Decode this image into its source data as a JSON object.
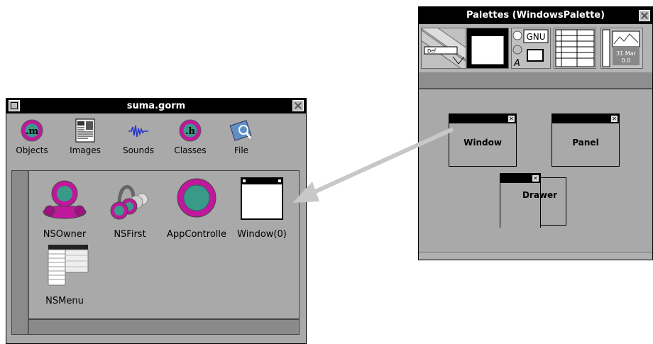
{
  "gorm_window": {
    "title": "suma.gorm",
    "toolbar": [
      {
        "label": "Objects",
        "icon": "objects-m-icon"
      },
      {
        "label": "Images",
        "icon": "images-icon"
      },
      {
        "label": "Sounds",
        "icon": "sounds-icon"
      },
      {
        "label": "Classes",
        "icon": "classes-h-icon"
      },
      {
        "label": "File",
        "icon": "file-icon"
      }
    ],
    "objects": [
      {
        "label": "NSOwner",
        "icon": "nsowner-icon"
      },
      {
        "label": "NSFirst",
        "icon": "nsfirst-icon"
      },
      {
        "label": "AppControlle",
        "icon": "appcontroller-icon"
      },
      {
        "label": "Window(0)",
        "icon": "window-icon"
      },
      {
        "label": "NSMenu",
        "icon": "nsmenu-icon"
      }
    ]
  },
  "palettes_window": {
    "title": "Palettes (WindowsPalette)",
    "strip": {
      "gnu_label": "GNU",
      "a_label": "A",
      "date_label": "31 Mar",
      "time_label": "0.0",
      "tab_label": "Def"
    },
    "items": {
      "window": "Window",
      "panel": "Panel",
      "drawer": "Drawer"
    }
  },
  "colors": {
    "window_bg": "#a9a9a9",
    "titlebar": "#000000",
    "magenta": "#c0189c",
    "teal": "#3a9a8a",
    "arrow": "#c8c8c8"
  }
}
